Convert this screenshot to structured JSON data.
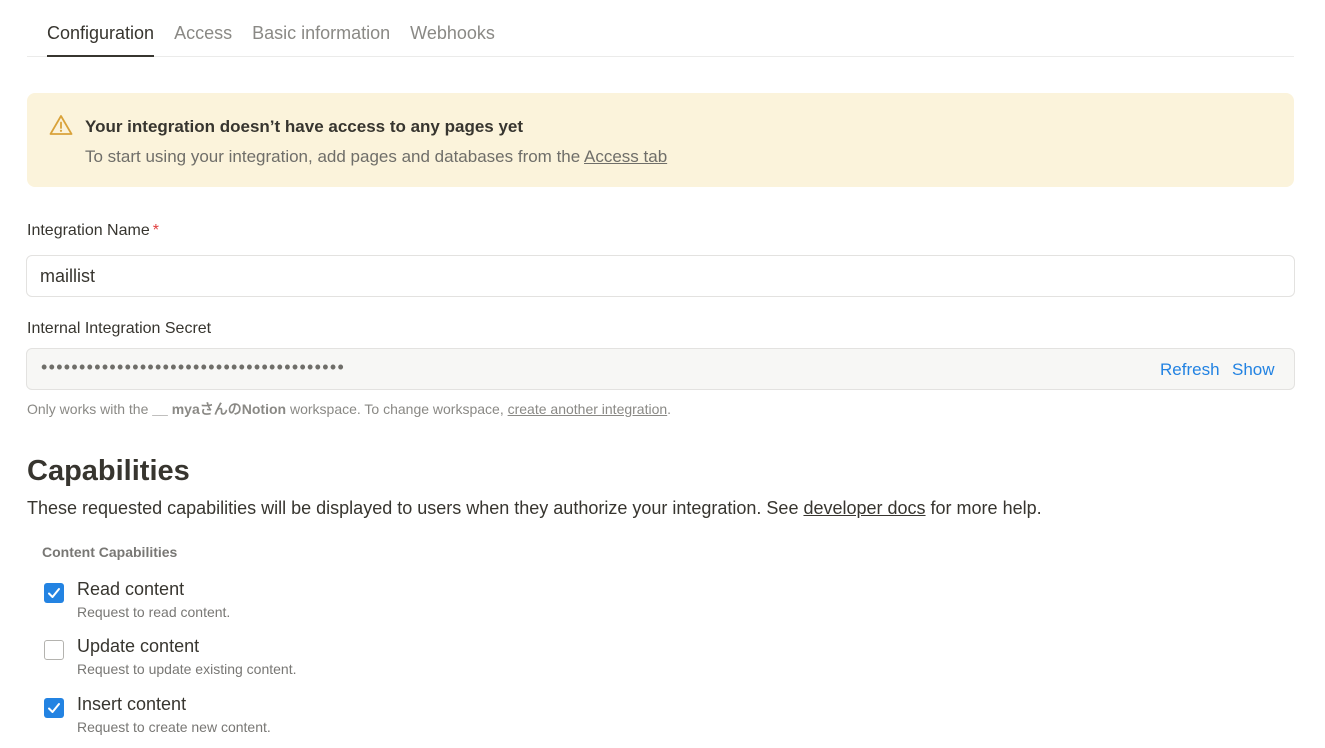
{
  "tabs": [
    {
      "label": "Configuration",
      "active": true
    },
    {
      "label": "Access",
      "active": false
    },
    {
      "label": "Basic information",
      "active": false
    },
    {
      "label": "Webhooks",
      "active": false
    }
  ],
  "banner": {
    "icon": "warning-triangle-icon",
    "title": "Your integration doesn’t have access to any pages yet",
    "text_prefix": "To start using your integration, add pages and databases from the ",
    "link": "Access tab"
  },
  "integration_name": {
    "label": "Integration Name",
    "required_mark": "*",
    "value": "maillist"
  },
  "secret": {
    "label": "Internal Integration Secret",
    "masked": "••••••••••••••••••••••••••••••••••••••••",
    "refresh_label": "Refresh",
    "show_label": "Show",
    "hint_prefix": "Only works with the ",
    "workspace": "__ myaさんのNotion",
    "hint_middle": " workspace. To change workspace, ",
    "hint_link": "create another integration",
    "hint_suffix": "."
  },
  "capabilities": {
    "title": "Capabilities",
    "desc_prefix": "These requested capabilities will be displayed to users when they authorize your integration. See ",
    "desc_link": "developer docs",
    "desc_suffix": " for more help.",
    "group_title": "Content Capabilities",
    "items": [
      {
        "label": "Read content",
        "desc": "Request to read content.",
        "checked": true
      },
      {
        "label": "Update content",
        "desc": "Request to update existing content.",
        "checked": false
      },
      {
        "label": "Insert content",
        "desc": "Request to create new content.",
        "checked": true
      }
    ]
  },
  "colors": {
    "accent": "#2383e2",
    "banner_bg": "#fbf3db",
    "warning_icon": "#d9a23a",
    "required": "#e03e3e"
  }
}
